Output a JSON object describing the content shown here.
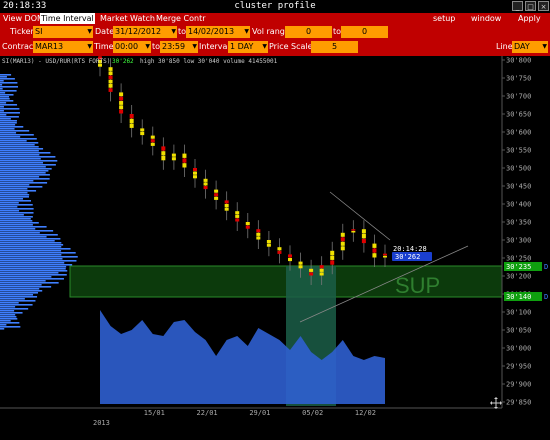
{
  "window": {
    "time": "20:18:33",
    "title": "cluster profile",
    "buttons": [
      "_",
      "□",
      "×"
    ]
  },
  "menu": {
    "left": [
      "View DOM",
      "Time Interval",
      "Market Watch",
      "Merge Contr"
    ],
    "active_index": 1,
    "right": [
      "setup",
      "window",
      "Apply"
    ]
  },
  "toolbar": {
    "ticker_label": "Ticker",
    "ticker": "SI",
    "date_label": "Date",
    "date_from": "31/12/2012",
    "to_label": "to",
    "date_to": "14/02/2013",
    "vol_range_label": "Vol range",
    "vol_from": "0",
    "vol_to_label": "to",
    "vol_to": "0",
    "contract_label": "Contract",
    "contract": "MAR13",
    "time_label": "Time",
    "time_from": "00:00",
    "time_to_label": "to",
    "time_to": "23:59",
    "interval_label": "Interval",
    "interval": "1 DAY",
    "price_scale_label": "Price Scale",
    "price_scale": "5",
    "line_label": "Line",
    "line": "DAY"
  },
  "chart": {
    "info_line": "SI(MAR13) - USD/RUR(RTS FORTS)",
    "info_last": "30'262",
    "info_stats": "high 30'850  low 30'040  volume 41455001",
    "cursor_time": "20:14:28",
    "cursor_price": "30'262",
    "sup_text": "SUP",
    "level_upper": "30'235",
    "level_lower": "30'140",
    "level_marker": "D",
    "year_label": "2013",
    "colors": {
      "menu_red": "#c00000",
      "field_orange": "#ff9c00",
      "sup_green": "#0c3a0c",
      "volume_blue": "#2f5fd0",
      "profile_blue": "#3f7fff",
      "candle_red": "#e00000",
      "candle_yellow": "#f0e000"
    }
  },
  "chart_data": {
    "type": "line",
    "title": "SI(MAR13) - USD/RUR(RTS FORTS)",
    "y_axis_ticks": [
      "30'800",
      "30'750",
      "30'700",
      "30'650",
      "30'600",
      "30'550",
      "30'500",
      "30'450",
      "30'400",
      "30'350",
      "30'300",
      "30'250",
      "30'200",
      "30'150",
      "30'100",
      "30'050",
      "30'000",
      "29'950",
      "29'900",
      "29'850"
    ],
    "ylim": [
      29850,
      30800
    ],
    "x_axis_ticks": [
      "15/01",
      "22/01",
      "29/01",
      "05/02",
      "12/02"
    ],
    "x": [
      "08/01",
      "09/01",
      "10/01",
      "11/01",
      "14/01",
      "15/01",
      "16/01",
      "17/01",
      "18/01",
      "21/01",
      "22/01",
      "23/01",
      "24/01",
      "25/01",
      "28/01",
      "29/01",
      "30/01",
      "31/01",
      "01/02",
      "04/02",
      "05/02",
      "06/02",
      "07/02",
      "08/02",
      "11/02",
      "12/02",
      "13/02",
      "14/02"
    ],
    "series": [
      {
        "values": [
          30780,
          30710,
          30650,
          30610,
          30590,
          30560,
          30520,
          30540,
          30500,
          30470,
          30440,
          30410,
          30380,
          30350,
          30330,
          30300,
          30280,
          30260,
          30240,
          30220,
          30200,
          30230,
          30270,
          30320,
          30330,
          30290,
          30250,
          30262
        ]
      }
    ],
    "levels": [
      30235,
      30140
    ],
    "grid": false,
    "legend": "none"
  }
}
